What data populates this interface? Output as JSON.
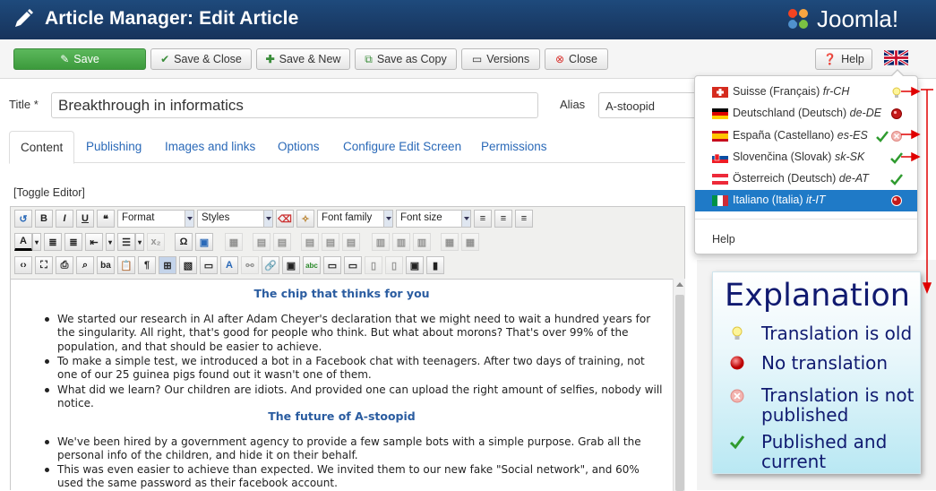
{
  "header": {
    "title": "Article Manager: Edit Article",
    "logo_text": "Joomla!"
  },
  "toolbar": {
    "save": "Save",
    "save_close": "Save & Close",
    "save_new": "Save & New",
    "save_copy": "Save as Copy",
    "versions": "Versions",
    "close": "Close",
    "help": "Help"
  },
  "form": {
    "title_label": "Title *",
    "title_value": "Breakthrough in informatics",
    "alias_label": "Alias",
    "alias_value": "A-stoopid"
  },
  "tabs": [
    "Content",
    "Publishing",
    "Images and links",
    "Options",
    "Configure Edit Screen",
    "Permissions"
  ],
  "toggle_editor": "[Toggle Editor]",
  "editor_toolbar": {
    "format": "Format",
    "styles": "Styles",
    "font_family": "Font family",
    "font_size": "Font size"
  },
  "content": {
    "heading1": "The chip that thinks for you",
    "bullets1": [
      "We started our research in AI after Adam Cheyer's declaration that we might need to wait a hundred years for the singularity.  All right, that's good for people who think. But what about morons? That's over 99% of the population, and that should be easier to achieve.",
      "To make a simple test, we introduced a bot in a Facebook chat with teenagers. After two days of training, not one of our 25 guinea pigs found out it wasn't one of them.",
      "What did we learn? Our children are idiots.  And provided one can upload the right amount of selfies, nobody will notice."
    ],
    "heading2": "The future of A-stoopid",
    "bullets2": [
      "We've been hired by a government agency to provide a few sample bots with a simple purpose. Grab all the personal info of the children, and hide it on their behalf.",
      "This was even easier to achieve than expected. We invited them to our new fake \"Social network\", and 60% used the same password as their facebook account."
    ]
  },
  "languages": [
    {
      "name": "Suisse (Français)",
      "code": "fr-CH",
      "status": "old",
      "flag": "ch"
    },
    {
      "name": "Deutschland (Deutsch)",
      "code": "de-DE",
      "status": "none",
      "flag": "de"
    },
    {
      "name": "España (Castellano)",
      "code": "es-ES",
      "status": "unpublished-check",
      "flag": "es"
    },
    {
      "name": "Slovenčina (Slovak)",
      "code": "sk-SK",
      "status": "published",
      "flag": "sk"
    },
    {
      "name": "Österreich (Deutsch)",
      "code": "de-AT",
      "status": "published",
      "flag": "at"
    },
    {
      "name": "Italiano (Italia)",
      "code": "it-IT",
      "status": "none",
      "flag": "it",
      "active": true
    }
  ],
  "dropdown_help": "Help",
  "explanation": {
    "title": "Explanation",
    "items": [
      {
        "icon": "bulb-icon",
        "text": "Translation is old"
      },
      {
        "icon": "red-dot-icon",
        "text": "No translation"
      },
      {
        "icon": "unpublished-icon",
        "text": "Translation is not published"
      },
      {
        "icon": "check-icon",
        "text": "Published and current"
      }
    ]
  },
  "colors": {
    "header": "#1b3a63",
    "save_green": "#4cae4c",
    "link_blue": "#2a69b8",
    "active_item": "#1f7ac7",
    "arrow_red": "#e00000"
  }
}
